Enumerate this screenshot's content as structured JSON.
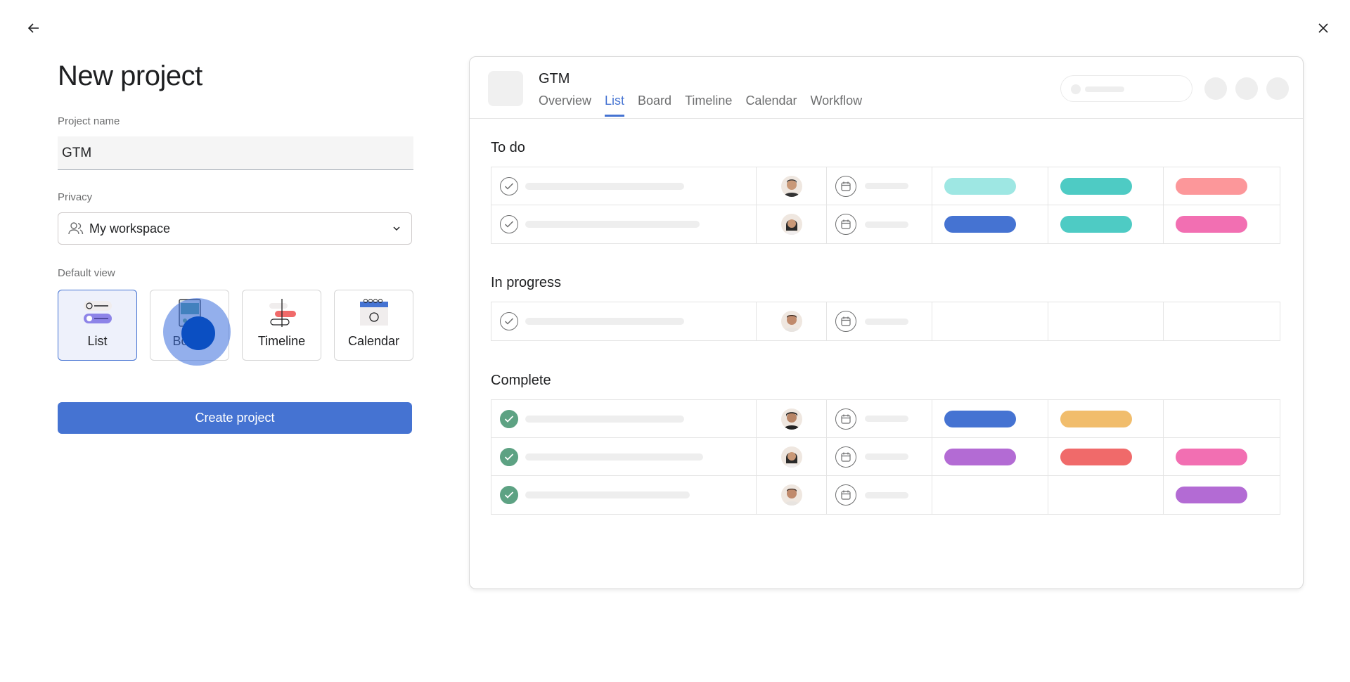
{
  "header": {
    "back_icon": "arrow-left-icon",
    "close_icon": "close-icon"
  },
  "form": {
    "title": "New project",
    "name_label": "Project name",
    "name_value": "GTM",
    "privacy_label": "Privacy",
    "privacy_value": "My workspace",
    "default_view_label": "Default view",
    "views": [
      {
        "label": "List",
        "selected": true
      },
      {
        "label": "Board",
        "selected": false
      },
      {
        "label": "Timeline",
        "selected": false
      },
      {
        "label": "Calendar",
        "selected": false
      }
    ],
    "create_label": "Create project"
  },
  "preview": {
    "project_name": "GTM",
    "tabs": [
      "Overview",
      "List",
      "Board",
      "Timeline",
      "Calendar",
      "Workflow"
    ],
    "active_tab": "List",
    "sections": [
      "To do",
      "In progress",
      "Complete"
    ],
    "colors": {
      "accent": "#4573d2",
      "done": "#5da283",
      "aqua": "#9ee7e3",
      "teal": "#4ecbc4",
      "blue": "#4573d2",
      "coral": "#fc979a",
      "pink": "#f26fb2",
      "yellow-orange": "#f1bd6c",
      "purple": "#b36bd4",
      "red": "#f06a6a"
    }
  }
}
